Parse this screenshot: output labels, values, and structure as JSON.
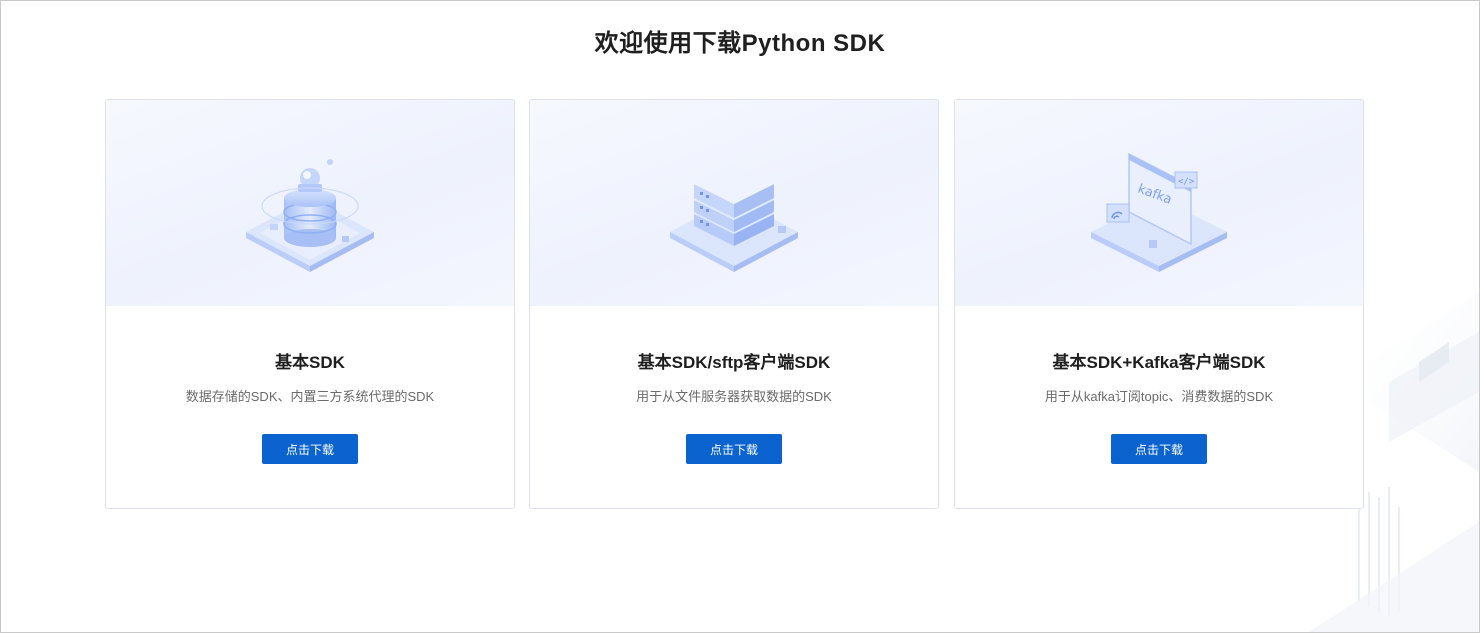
{
  "page": {
    "title": "欢迎使用下载Python SDK"
  },
  "cards": [
    {
      "title": "基本SDK",
      "description": "数据存储的SDK、内置三方系统代理的SDK",
      "button_label": "点击下载",
      "icon": "database-stack-icon"
    },
    {
      "title": "基本SDK/sftp客户端SDK",
      "description": "用于从文件服务器获取数据的SDK",
      "button_label": "点击下载",
      "icon": "server-rack-icon"
    },
    {
      "title": "基本SDK+Kafka客户端SDK",
      "description": "用于从kafka订阅topic、消费数据的SDK",
      "button_label": "点击下载",
      "icon": "kafka-window-icon",
      "icon_text": "kafka"
    }
  ],
  "colors": {
    "accent": "#0a63cf",
    "title_text": "#1f1f1f",
    "description_text": "#6b6b6b",
    "card_border": "#dfe2e8",
    "illustration_blue": "#8fb0f5"
  }
}
